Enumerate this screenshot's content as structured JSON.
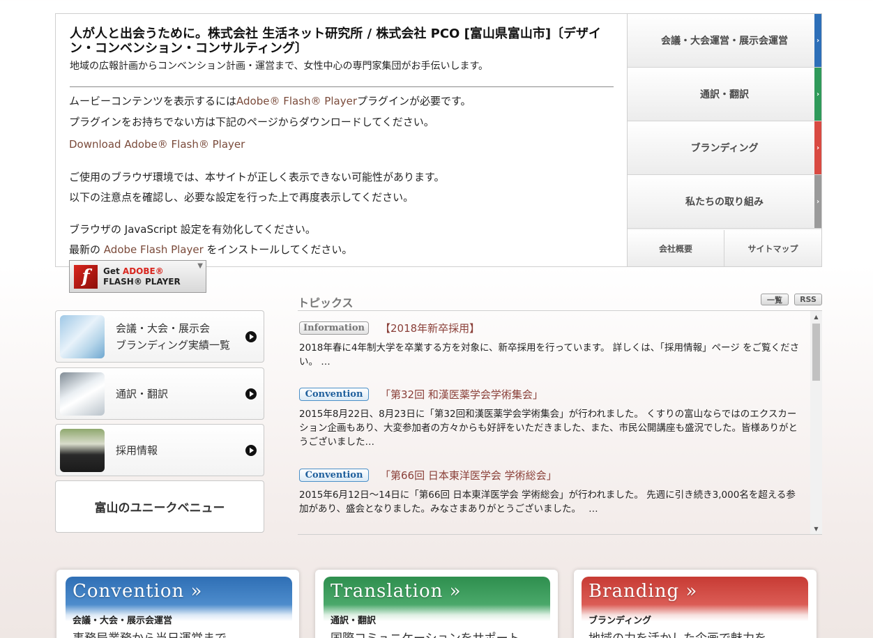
{
  "header": {
    "title": "人が人と出会うために。株式会社 生活ネット研究所 / 株式会社 PCO [富山県富山市]〔デザイン・コンベンション・コンサルティング〕",
    "lead": "地域の広報計画からコンベンション計画・運営まで、女性中心の専門家集団がお手伝いします。"
  },
  "flash_notice": {
    "line1_pre": "ムービーコンテンツを表示するには",
    "line1_link": "Adobe® Flash® Player",
    "line1_post": "プラグインが必要です。",
    "line2": "プラグインをお持ちでない方は下記のページからダウンロードしてください。",
    "download_link": "Download Adobe® Flash® Player",
    "line3": "ご使用のブラウザ環境では、本サイトが正しく表示できない可能性があります。",
    "line4": "以下の注意点を確認し、必要な設定を行った上で再度表示してください。",
    "line5": "ブラウザの JavaScript 設定を有効化してください。",
    "line6_pre": "最新の",
    "line6_link": "Adobe Flash Player",
    "line6_post": "をインストールしてください。"
  },
  "flash_badge": {
    "get": "Get ",
    "adobe": "ADOBE®",
    "player": "FLASH® PLAYER"
  },
  "right_nav": {
    "items": [
      {
        "label": "会議・大会運営・展示会運営",
        "color": "#2d6fb8"
      },
      {
        "label": "通訳・翻訳",
        "color": "#2f9a5a"
      },
      {
        "label": "ブランディング",
        "color": "#d94a42"
      },
      {
        "label": "私たちの取り組み",
        "color": "#9a9a9a"
      }
    ],
    "sub_items": [
      "会社概要",
      "サイトマップ"
    ]
  },
  "side_buttons": [
    {
      "label_line1": "会議・大会・展示会",
      "label_line2": "ブランディング実績一覧"
    },
    {
      "label_line1": "通訳・翻訳",
      "label_line2": ""
    },
    {
      "label_line1": "採用情報",
      "label_line2": ""
    }
  ],
  "venue_button": "富山のユニークベニュー",
  "topics": {
    "title": "トピックス",
    "list_button": "一覧",
    "rss_button": "RSS",
    "items": [
      {
        "badge": "Information",
        "title": "【2018年新卒採用】",
        "body": "2018年春に4年制大学を卒業する方を対象に、新卒採用を行っています。 詳しくは、「採用情報」ページ をご覧ください。 …"
      },
      {
        "badge": "Convention",
        "title": "「第32回 和漢医薬学会学術集会」",
        "body": "2015年8月22日、8月23日に「第32回和漢医薬学会学術集会」が行われました。 くすりの富山ならではのエクスカーション企画もあり、大変参加者の方々からも好評をいただきました、また、市民公開講座も盛況でした。皆様ありがとうございました…"
      },
      {
        "badge": "Convention",
        "title": "「第66回 日本東洋医学会 学術総会」",
        "body": "2015年6月12日～14日に「第66回 日本東洋医学会 学術総会」が行われました。 先週に引き続き3,000名を超える参加があり、盛会となりました。みなさまありがとうございました。　 …"
      }
    ]
  },
  "service_cards": [
    {
      "en": "Convention »",
      "jp": "会議・大会・展示会運営",
      "desc": "事務局業務から当日運営まで",
      "color": "#2f6fb5"
    },
    {
      "en": "Translation »",
      "jp": "通訳・翻訳",
      "desc": "国際コミュニケーションをサポート",
      "color": "#2e8f4e"
    },
    {
      "en": "Branding »",
      "jp": "ブランディング",
      "desc": "地域の力を活かした企画で魅力を",
      "color": "#c73b34"
    }
  ]
}
